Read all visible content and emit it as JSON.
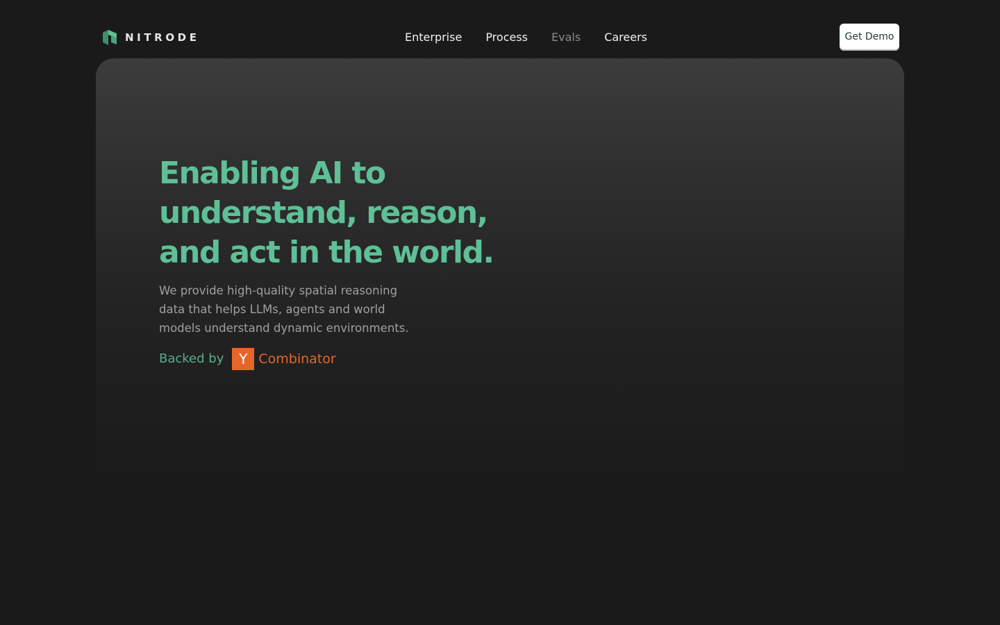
{
  "brand": {
    "name": "NITRODE",
    "accent_color": "#5fbf96",
    "logo_icon": "nitrode-logo-icon"
  },
  "nav": {
    "items": [
      {
        "label": "Enterprise"
      },
      {
        "label": "Process"
      },
      {
        "label": "Evals"
      },
      {
        "label": "Careers"
      }
    ],
    "cta_label": "Get Demo"
  },
  "hero": {
    "headline_lines": [
      "Enabling AI to",
      "understand, reason,",
      "and act in the world."
    ],
    "subtext_lines": [
      "We provide high-quality spatial reasoning",
      "data that helps LLMs, agents and world",
      "models understand dynamic environments."
    ],
    "backed_by_label": "Backed by",
    "backer": {
      "logo_letter": "Y",
      "name": "Combinator",
      "color": "#e6662a"
    }
  }
}
